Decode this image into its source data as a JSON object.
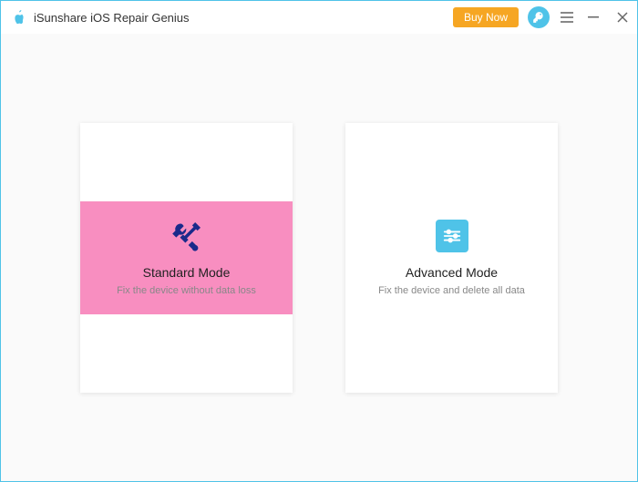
{
  "header": {
    "title": "iSunshare iOS Repair Genius",
    "buy_now": "Buy Now"
  },
  "options": {
    "standard": {
      "title": "Standard Mode",
      "desc": "Fix the device without data loss"
    },
    "advanced": {
      "title": "Advanced Mode",
      "desc": "Fix the device and delete all data"
    }
  },
  "colors": {
    "accent": "#4fc3e8",
    "highlight": "#f88ec0",
    "buy": "#f6a623"
  }
}
